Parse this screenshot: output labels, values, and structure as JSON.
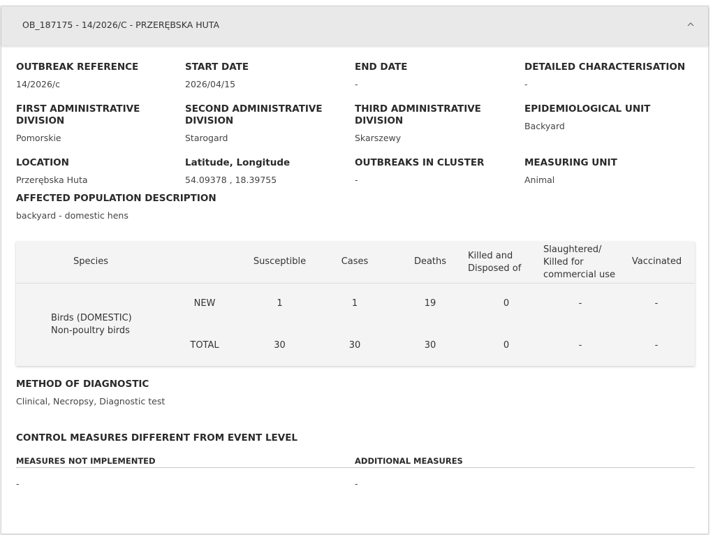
{
  "header": {
    "title": "OB_187175 - 14/2026/C - PRZERĘBSKA HUTA"
  },
  "fields": {
    "outbreak_reference": {
      "label": "OUTBREAK REFERENCE",
      "value": "14/2026/c"
    },
    "start_date": {
      "label": "START DATE",
      "value": "2026/04/15"
    },
    "end_date": {
      "label": "END DATE",
      "value": "-"
    },
    "detailed_characterisation": {
      "label": "DETAILED CHARACTERISATION",
      "value": "-"
    },
    "first_admin": {
      "label": "FIRST ADMINISTRATIVE DIVISION",
      "value": "Pomorskie"
    },
    "second_admin": {
      "label": "SECOND ADMINISTRATIVE DIVISION",
      "value": "Starogard"
    },
    "third_admin": {
      "label": "THIRD ADMINISTRATIVE DIVISION",
      "value": "Skarszewy"
    },
    "epi_unit": {
      "label": "EPIDEMIOLOGICAL UNIT",
      "value": "Backyard"
    },
    "location": {
      "label": "LOCATION",
      "value": "Przerębska Huta"
    },
    "lat_long": {
      "label": "Latitude, Longitude",
      "value": "54.09378 , 18.39755"
    },
    "outbreaks_in_cluster": {
      "label": "OUTBREAKS IN CLUSTER",
      "value": "-"
    },
    "measuring_unit": {
      "label": "MEASURING UNIT",
      "value": "Animal"
    },
    "affected_population": {
      "label": "AFFECTED POPULATION DESCRIPTION",
      "value": "backyard - domestic hens"
    }
  },
  "table": {
    "headers": {
      "species": "Species",
      "susceptible": "Susceptible",
      "cases": "Cases",
      "deaths": "Deaths",
      "killed_line1": "Killed and",
      "killed_line2": "Disposed of",
      "slaughtered_line1": "Slaughtered/",
      "slaughtered_line2": "Killed for",
      "slaughtered_line3": "commercial use",
      "vaccinated": "Vaccinated"
    },
    "species_line1": "Birds (DOMESTIC)",
    "species_line2": "Non-poultry birds",
    "rows": [
      {
        "label": "NEW",
        "susceptible": "1",
        "cases": "1",
        "deaths": "19",
        "killed": "0",
        "slaughtered": "-",
        "vaccinated": "-"
      },
      {
        "label": "TOTAL",
        "susceptible": "30",
        "cases": "30",
        "deaths": "30",
        "killed": "0",
        "slaughtered": "-",
        "vaccinated": "-"
      }
    ]
  },
  "diagnostic": {
    "label": "METHOD OF DIAGNOSTIC",
    "value": "Clinical, Necropsy, Diagnostic test"
  },
  "control_measures": {
    "title": "CONTROL MEASURES DIFFERENT FROM EVENT LEVEL",
    "not_implemented_label": "MEASURES NOT IMPLEMENTED",
    "not_implemented_value": "-",
    "additional_label": "ADDITIONAL MEASURES",
    "additional_value": "-"
  }
}
